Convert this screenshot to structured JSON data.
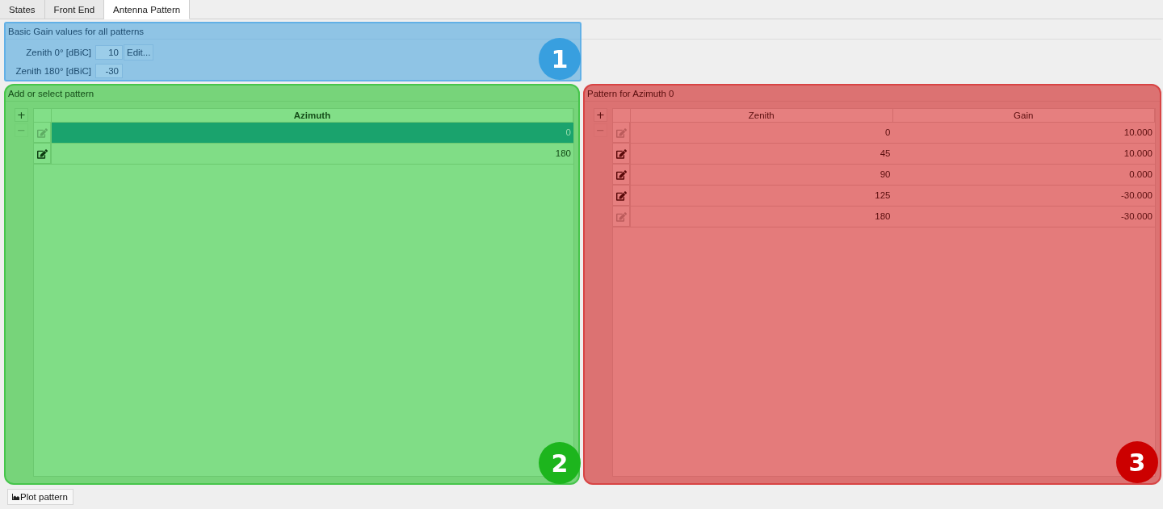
{
  "tabs": [
    {
      "label": "States",
      "selected": false
    },
    {
      "label": "Front End",
      "selected": false
    },
    {
      "label": "Antenna Pattern",
      "selected": true
    }
  ],
  "basic_gain": {
    "title": "Basic Gain values for all patterns",
    "badge": "1",
    "fields": [
      {
        "label": "Zenith 0° [dBiC]",
        "value": "10",
        "button": "Edit..."
      },
      {
        "label": "Zenith 180° [dBiC]",
        "value": "-30"
      }
    ]
  },
  "pattern_list": {
    "title": "Add or select pattern",
    "badge": "2",
    "buttons": [
      {
        "label": "+",
        "disabled": false
      },
      {
        "label": "−",
        "disabled": true
      }
    ],
    "columns": [
      "Azimuth"
    ],
    "rows": [
      {
        "cells": [
          "0"
        ],
        "selected": true,
        "edit_disabled": true
      },
      {
        "cells": [
          "180"
        ],
        "selected": false,
        "edit_disabled": false
      }
    ]
  },
  "pattern_table": {
    "title": "Pattern for Azimuth 0",
    "badge": "3",
    "buttons": [
      {
        "label": "+",
        "disabled": false
      },
      {
        "label": "−",
        "disabled": true
      }
    ],
    "columns": [
      "Zenith",
      "Gain"
    ],
    "rows": [
      {
        "cells": [
          "0",
          "10.000"
        ],
        "selected": false,
        "edit_disabled": true
      },
      {
        "cells": [
          "45",
          "10.000"
        ],
        "selected": false,
        "edit_disabled": false
      },
      {
        "cells": [
          "90",
          "0.000"
        ],
        "selected": false,
        "edit_disabled": false
      },
      {
        "cells": [
          "125",
          "-30.000"
        ],
        "selected": false,
        "edit_disabled": false
      },
      {
        "cells": [
          "180",
          "-30.000"
        ],
        "selected": false,
        "edit_disabled": true
      }
    ]
  },
  "plot_button": {
    "label": "Plot pattern"
  }
}
